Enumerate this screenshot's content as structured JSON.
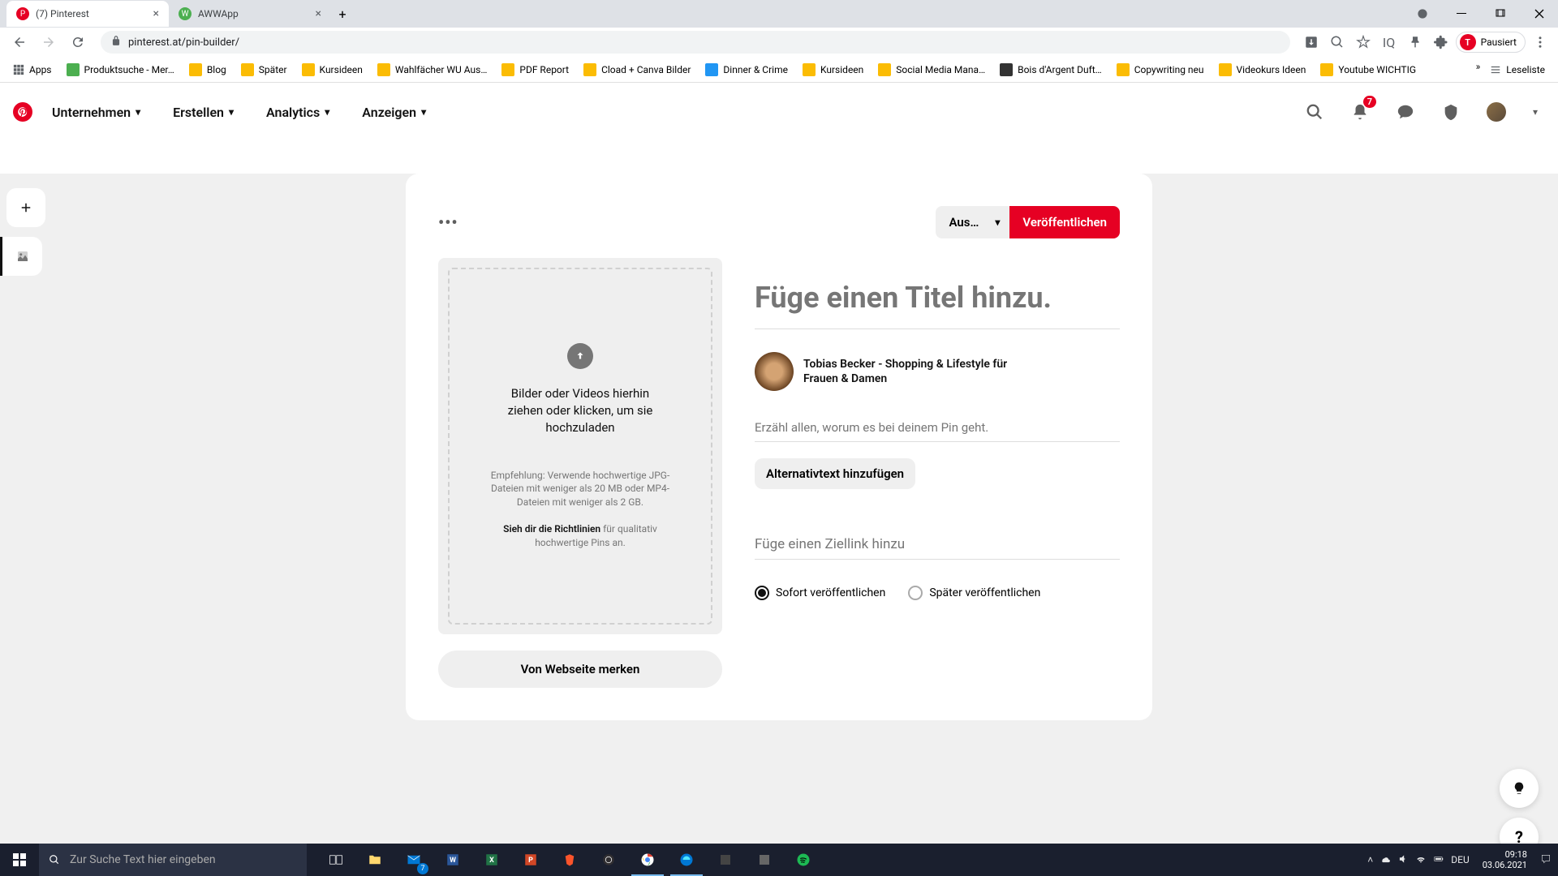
{
  "browser": {
    "tabs": [
      {
        "title": "(7) Pinterest",
        "active": true
      },
      {
        "title": "AWWApp",
        "active": false
      }
    ],
    "url": "pinterest.at/pin-builder/",
    "profile_status": "Pausiert",
    "profile_initial": "T",
    "apps_label": "Apps",
    "bookmarks": [
      "Produktsuche - Mer…",
      "Blog",
      "Später",
      "Kursideen",
      "Wahlfächer WU Aus…",
      "PDF Report",
      "Cload + Canva Bilder",
      "Dinner & Crime",
      "Kursideen",
      "Social Media Mana…",
      "Bois d'Argent Duft…",
      "Copywriting neu",
      "Videokurs Ideen",
      "Youtube WICHTIG"
    ],
    "reading_list": "Leseliste"
  },
  "header": {
    "nav": [
      "Unternehmen",
      "Erstellen",
      "Analytics",
      "Anzeigen"
    ],
    "notification_count": "7"
  },
  "builder": {
    "board_selector": "Aus…",
    "publish": "Veröffentlichen",
    "upload_main": "Bilder oder Videos hierhin ziehen oder klicken, um sie hochzuladen",
    "upload_hint": "Empfehlung: Verwende hochwertige JPG-Dateien mit weniger als 20 MB oder MP4-Dateien mit weniger als 2 GB.",
    "guidelines_strong": "Sieh dir die Richtlinien",
    "guidelines_rest": " für qualitativ hochwertige Pins an.",
    "save_from_web": "Von Webseite merken",
    "title_placeholder": "Füge einen Titel hinzu.",
    "user_name": "Tobias Becker - Shopping & Lifestyle für Frauen & Damen",
    "desc_placeholder": "Erzähl allen, worum es bei deinem Pin geht.",
    "alt_text": "Alternativtext hinzufügen",
    "link_placeholder": "Füge einen Ziellink hinzu",
    "radio_now": "Sofort veröffentlichen",
    "radio_later": "Später veröffentlichen"
  },
  "taskbar": {
    "search_placeholder": "Zur Suche Text hier eingeben",
    "lang": "DEU",
    "time": "09:18",
    "date": "03.06.2021",
    "mail_badge": "7"
  },
  "float": {
    "help": "?"
  }
}
